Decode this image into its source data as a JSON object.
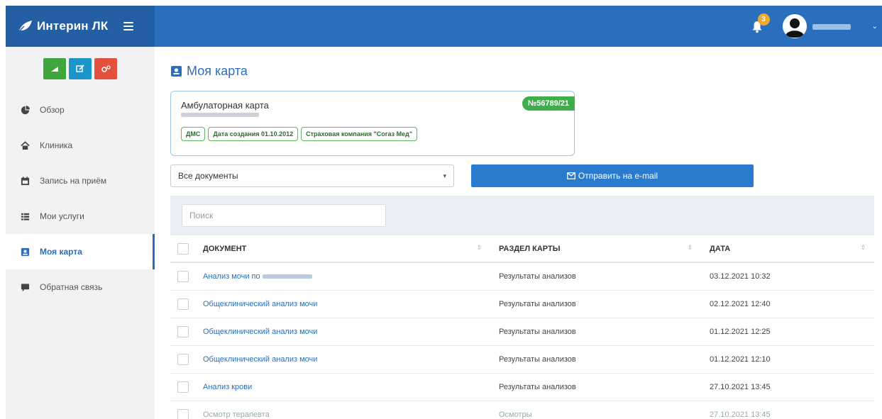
{
  "header": {
    "brand_name": "Интерин ЛК",
    "notifications_count": "3",
    "accent_color": "#2a6fbd"
  },
  "sidebar": {
    "quick_actions": [
      {
        "icon": "signal-bars-icon",
        "color": "#3ea63d"
      },
      {
        "icon": "edit-icon",
        "color": "#1e95c9"
      },
      {
        "icon": "gears-icon",
        "color": "#e3503e"
      }
    ],
    "items": [
      {
        "label": "Обзор",
        "icon": "pie-chart-icon"
      },
      {
        "label": "Клиника",
        "icon": "home-icon"
      },
      {
        "label": "Запись на приём",
        "icon": "calendar-icon"
      },
      {
        "label": "Мои услуги",
        "icon": "list-icon"
      },
      {
        "label": "Моя карта",
        "icon": "card-icon",
        "active": true
      },
      {
        "label": "Обратная связь",
        "icon": "comment-icon"
      }
    ]
  },
  "main": {
    "title": "Моя карта",
    "card": {
      "title": "Амбулаторная карта",
      "number": "№56789/21",
      "tags": [
        "ДМС",
        "Дата создания 01.10.2012",
        "Страховая компания \"Согаз Мед\""
      ]
    },
    "filter_value": "Все документы",
    "send_label": "Отправить на e-mail",
    "search_placeholder": "Поиск",
    "table": {
      "headers": {
        "document": "ДОКУМЕНТ",
        "section": "РАЗДЕЛ КАРТЫ",
        "date": "ДАТА"
      },
      "rows": [
        {
          "document": "Анализ мочи по",
          "section": "Результаты анализов",
          "date": "03.12.2021 10:32"
        },
        {
          "document": "Общеклинический анализ мочи",
          "section": "Результаты анализов",
          "date": "02.12.2021 12:40"
        },
        {
          "document": "Общеклинический анализ мочи",
          "section": "Результаты анализов",
          "date": "01.12.2021 12:25"
        },
        {
          "document": "Общеклинический анализ мочи",
          "section": "Результаты анализов",
          "date": "01.12.2021 12:10"
        },
        {
          "document": "Анализ крови",
          "section": "Результаты анализов",
          "date": "27.10.2021 13:45"
        },
        {
          "document": "Осмотр терапевта",
          "section": "Осмотры",
          "date": "27.10.2021 13:45"
        }
      ]
    }
  }
}
